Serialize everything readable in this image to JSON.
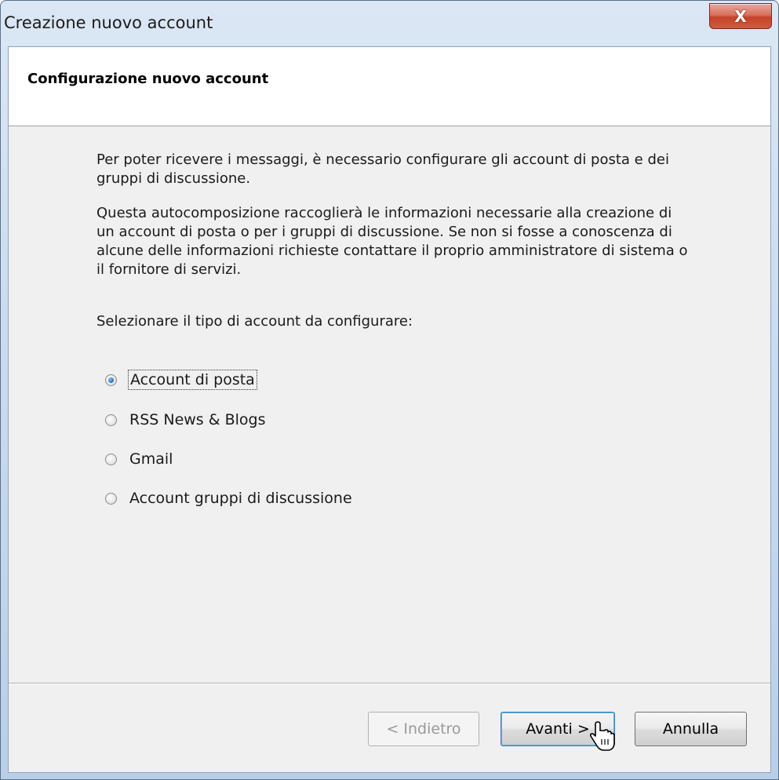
{
  "window": {
    "title": "Creazione nuovo account",
    "close_glyph": "X"
  },
  "page": {
    "title": "Configurazione nuovo account"
  },
  "body": {
    "paragraph1": "Per poter ricevere i messaggi, è necessario configurare gli account di posta e dei gruppi di discussione.",
    "paragraph2": "Questa autocomposizione raccoglierà le informazioni necessarie alla creazione di un account di posta o per i gruppi di discussione. Se non si fosse a conoscenza di alcune delle informazioni richieste contattare il proprio amministratore di sistema o il fornitore di servizi.",
    "paragraph3": "Selezionare il tipo di account da configurare:"
  },
  "options": [
    {
      "label": "Account di posta",
      "checked": true
    },
    {
      "label": "RSS News & Blogs",
      "checked": false
    },
    {
      "label": "Gmail",
      "checked": false
    },
    {
      "label": "Account gruppi di discussione",
      "checked": false
    }
  ],
  "buttons": {
    "back": "< Indietro",
    "next": "Avanti >",
    "cancel": "Annulla"
  },
  "icons": {
    "close": "close-icon",
    "cursor": "hand-pointer-icon"
  },
  "colors": {
    "title_bar": "#c9dbef",
    "close_button": "#c4432a",
    "dialog_bg": "#f0f0f0"
  }
}
